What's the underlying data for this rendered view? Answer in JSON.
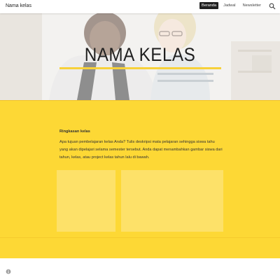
{
  "header": {
    "site_title": "Nama kelas",
    "nav": [
      {
        "label": "Beranda",
        "active": true
      },
      {
        "label": "Jadwal",
        "active": false
      },
      {
        "label": "Newsletter",
        "active": false
      }
    ],
    "search_icon": "search-icon"
  },
  "hero": {
    "title": "NAMA KELAS",
    "underline_color": "#f7d13a"
  },
  "summary": {
    "heading": "Ringkasan kelas",
    "body": "Apa tujuan pembelajaran kelas Anda? Tulis deskripsi mata pelajaran sehingga siswa tahu yang akan dipelajari selama semester tersebut. Anda dapat menambahkan gambar siswa dari tahun, kelas, atau project kelas tahun lalu di bawah."
  },
  "colors": {
    "section_bg": "#fdd835",
    "placeholder": "#fde169"
  },
  "footer": {
    "icon": "info-icon"
  }
}
